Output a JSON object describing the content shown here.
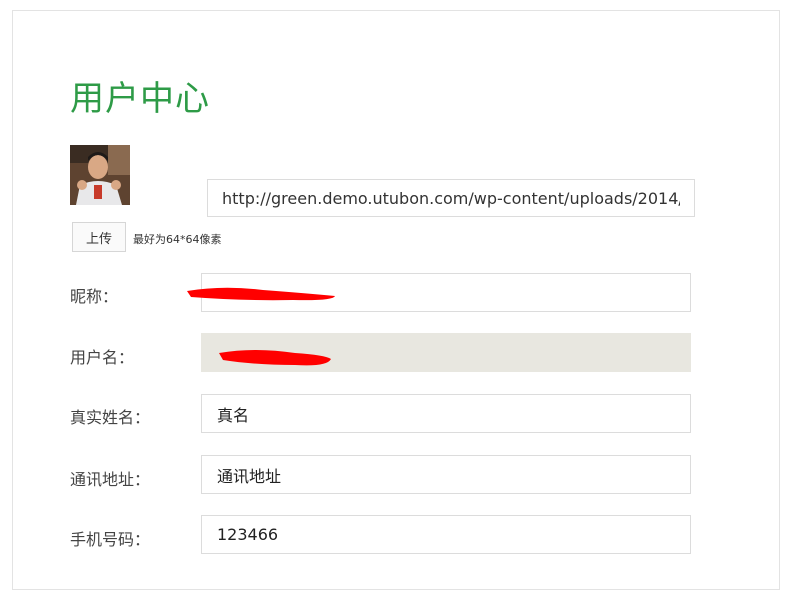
{
  "page": {
    "title": "用户中心"
  },
  "avatar": {
    "url_value": "http://green.demo.utubon.com/wp-content/uploads/2014/1",
    "upload_label": "上传",
    "hint": "最好为64*64像素"
  },
  "form": {
    "nickname": {
      "label": "昵称：",
      "value": ""
    },
    "username": {
      "label": "用户名：",
      "value": ""
    },
    "realname": {
      "label": "真实姓名：",
      "value": "真名"
    },
    "address": {
      "label": "通讯地址：",
      "value": "通讯地址"
    },
    "phone": {
      "label": "手机号码：",
      "value": "123466"
    }
  },
  "colors": {
    "title": "#2e9b47",
    "readonly_bg": "#e8e7e0",
    "redaction": "#ff0000"
  }
}
